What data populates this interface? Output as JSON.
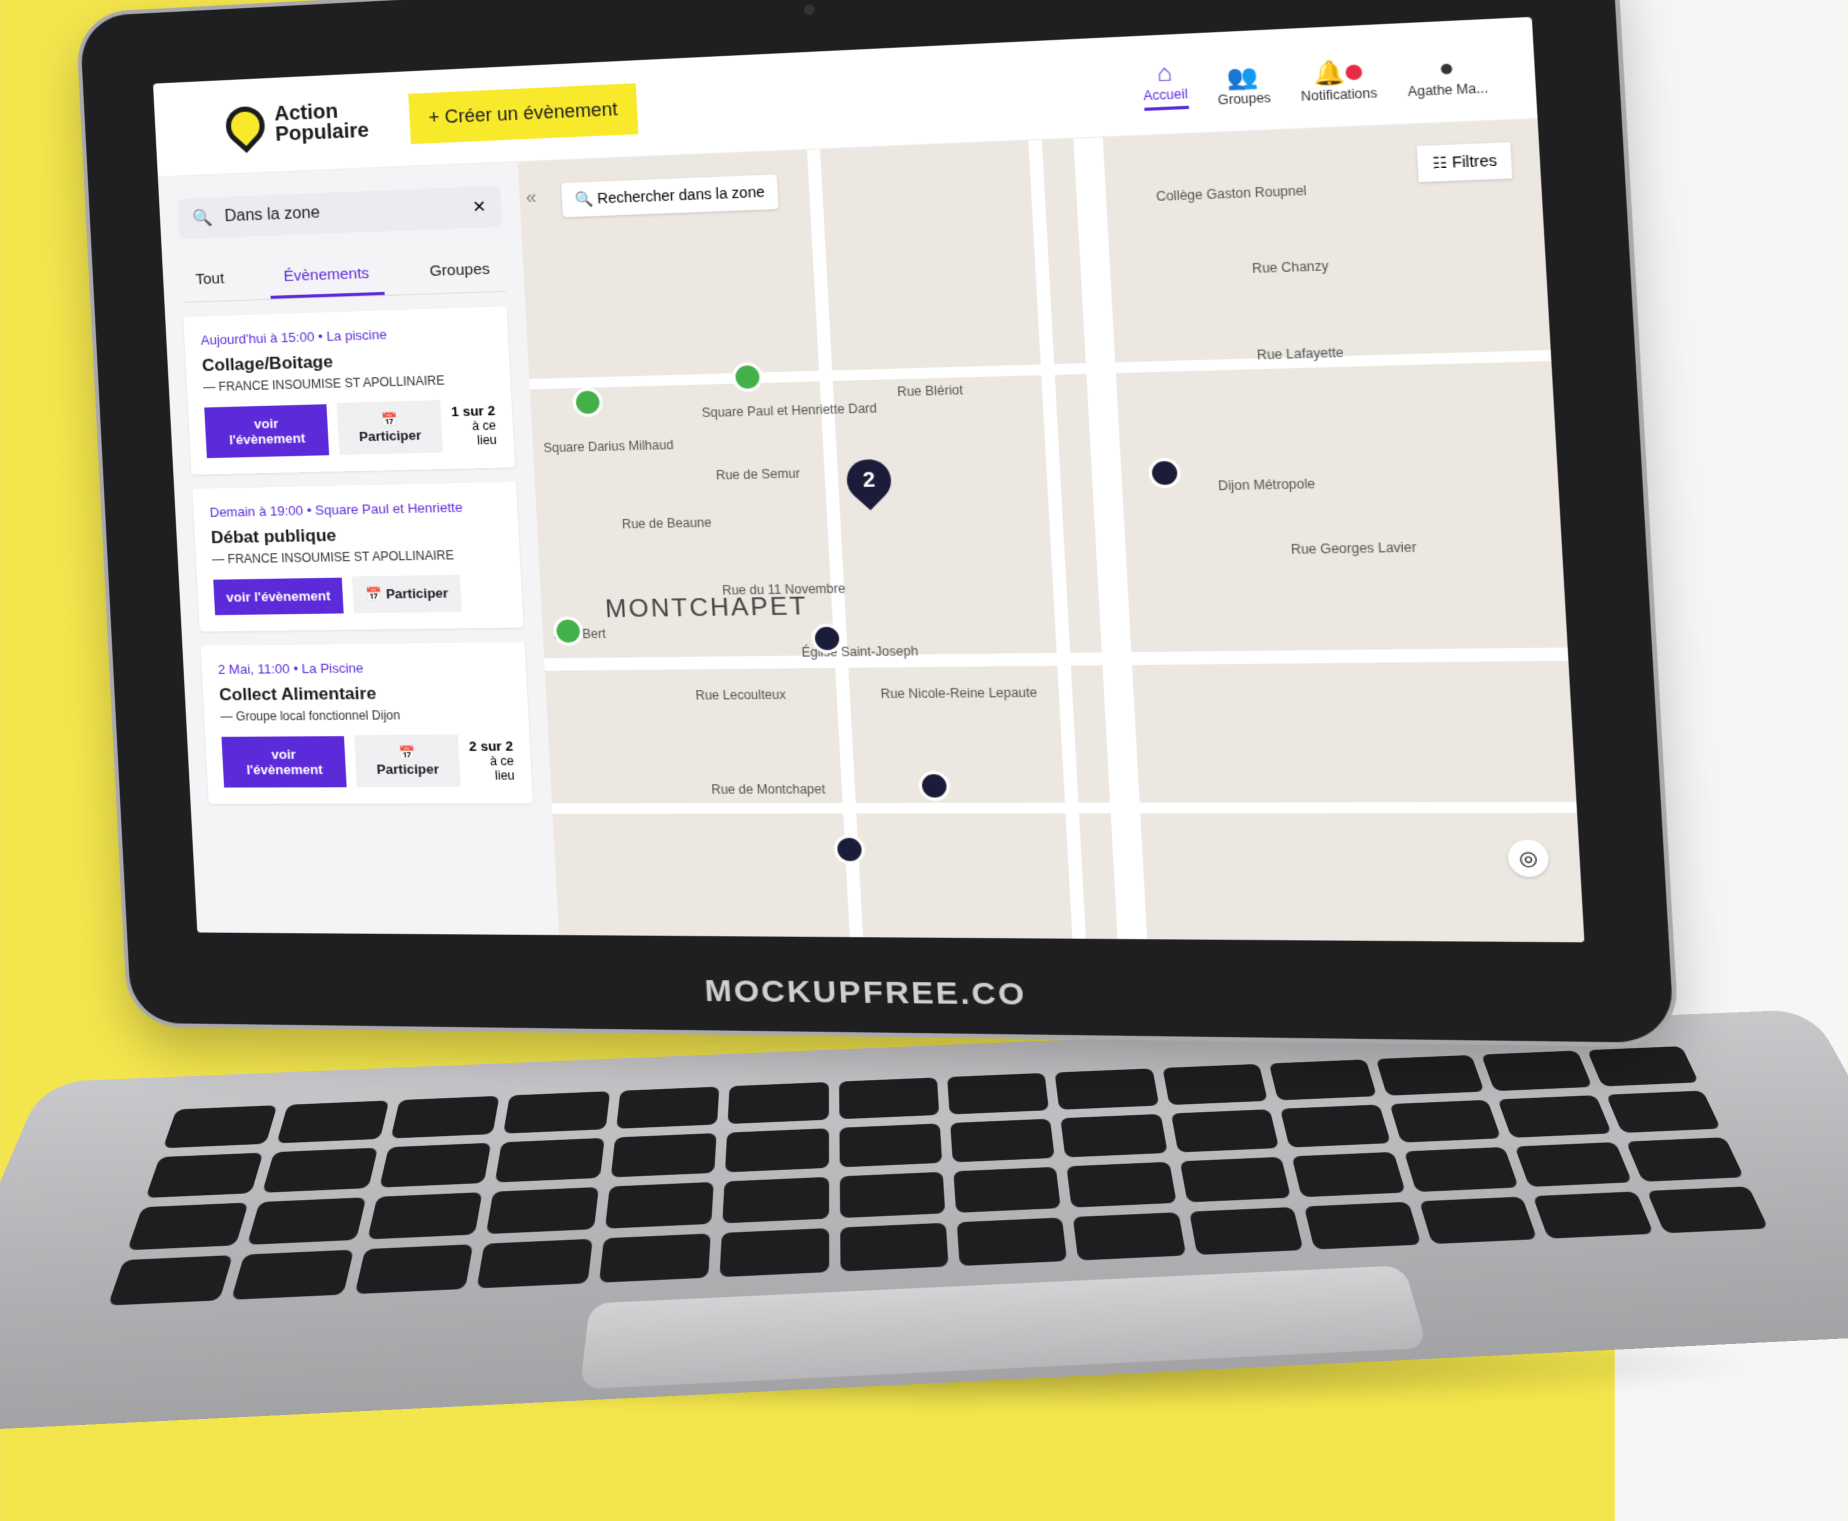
{
  "header": {
    "logo_line1": "Action",
    "logo_line2": "Populaire",
    "create_label": "+ Créer un évènement",
    "nav": {
      "home": "Accueil",
      "groups": "Groupes",
      "notifications": "Notifications",
      "profile": "Agathe Ma..."
    }
  },
  "sidebar": {
    "search_value": "Dans la zone",
    "tabs": [
      "Tout",
      "Évènements",
      "Groupes"
    ],
    "events": [
      {
        "meta": "Aujourd'hui à 15:00 • La piscine",
        "title": "Collage/Boitage",
        "org": "— FRANCE INSOUMISE ST APOLLINAIRE",
        "primary": "voir l'évènement",
        "secondary": "Participer",
        "count_main": "1 sur 2",
        "count_sub": "à ce lieu"
      },
      {
        "meta": "Demain à 19:00 • Square Paul et Henriette",
        "title": "Débat publique",
        "org": "— FRANCE INSOUMISE ST APOLLINAIRE",
        "primary": "voir l'évènement",
        "secondary": "Participer",
        "count_main": "",
        "count_sub": ""
      },
      {
        "meta": "2 Mai, 11:00 • La Piscine",
        "title": "Collect Alimentaire",
        "org": "— Groupe local fonctionnel Dijon",
        "primary": "voir l'évènement",
        "secondary": "Participer",
        "count_main": "2 sur 2",
        "count_sub": "à ce lieu"
      }
    ]
  },
  "map": {
    "search_label": "Rechercher dans la zone",
    "filters_label": "Filtres",
    "cluster_count": "2",
    "district": "MONTCHAPET",
    "labels": {
      "rue_chanzy": "Rue Chanzy",
      "rue_lafayette": "Rue Lafayette",
      "rue_bleriot": "Rue Blériot",
      "rue_de_semur": "Rue de Semur",
      "rue_de_beaune": "Rue de Beaune",
      "rue_11_novembre": "Rue du 11 Novembre",
      "rue_lecoulteux": "Rue Lecoulteux",
      "rue_nicole_reine": "Rue Nicole-Reine Lepaute",
      "rue_montchapet": "Rue de Montchapet",
      "rue_georges": "Rue Georges Lavier",
      "square_paul": "Square Paul et Henriette Dard",
      "square_darius": "Square Darius Milhaud",
      "dijon_metropole": "Dijon Métropole",
      "eglise": "Église Saint-Joseph",
      "college": "Collège Gaston Roupnel",
      "paul_bert": "Paul Bert"
    }
  },
  "device": {
    "brand": "MOCKUPFREE.CO"
  },
  "colors": {
    "accent": "#5b2bd9",
    "brand_yellow": "#f8ea2b",
    "background": "#f3e54c"
  }
}
